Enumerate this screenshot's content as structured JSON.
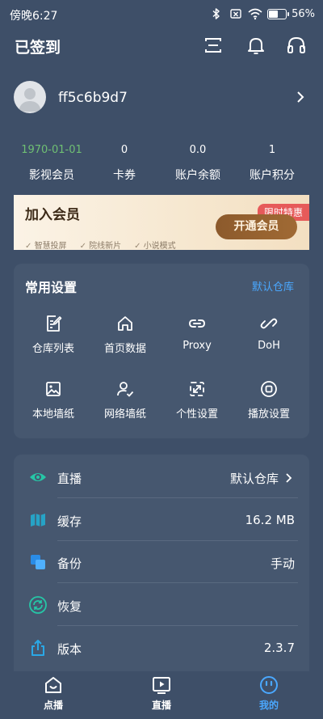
{
  "status_bar": {
    "time": "傍晚6:27",
    "battery_text": "56%",
    "battery_level": 0.56
  },
  "header": {
    "title": "已签到",
    "icons": [
      "scan-icon",
      "bell-icon",
      "headset-icon"
    ]
  },
  "profile": {
    "username": "ff5c6b9d7"
  },
  "stats": [
    {
      "value": "1970-01-01",
      "label": "影视会员",
      "value_color": "#6fbf73"
    },
    {
      "value": "0",
      "label": "卡券"
    },
    {
      "value": "0.0",
      "label": "账户余额"
    },
    {
      "value": "1",
      "label": "账户积分"
    }
  ],
  "vip": {
    "title": "加入会员",
    "badge": "限时特惠",
    "button": "开通会员",
    "features": [
      "智慧投屏",
      "院线新片",
      "小说模式"
    ]
  },
  "settings": {
    "title": "常用设置",
    "link": "默认仓库",
    "items": [
      {
        "label": "仓库列表",
        "icon": "document-edit-icon"
      },
      {
        "label": "首页数据",
        "icon": "home-icon"
      },
      {
        "label": "Proxy",
        "icon": "link-icon"
      },
      {
        "label": "DoH",
        "icon": "chain-icon"
      },
      {
        "label": "本地墙纸",
        "icon": "image-icon"
      },
      {
        "label": "网络墙纸",
        "icon": "user-check-icon"
      },
      {
        "label": "个性设置",
        "icon": "expand-icon"
      },
      {
        "label": "播放设置",
        "icon": "stop-circle-icon"
      }
    ]
  },
  "list": [
    {
      "label": "直播",
      "value": "默认仓库",
      "icon": "eye-icon",
      "has_chevron": true
    },
    {
      "label": "缓存",
      "value": "16.2 MB",
      "icon": "map-icon"
    },
    {
      "label": "备份",
      "value": "手动",
      "icon": "copy-icon"
    },
    {
      "label": "恢复",
      "value": "",
      "icon": "refresh-icon"
    },
    {
      "label": "版本",
      "value": "2.3.7",
      "icon": "share-icon"
    }
  ],
  "bottom_nav": [
    {
      "label": "点播",
      "icon": "home-smile-icon"
    },
    {
      "label": "直播",
      "icon": "play-screen-icon"
    },
    {
      "label": "我的",
      "icon": "profile-icon",
      "active": true
    }
  ],
  "colors": {
    "background": "#3e4f68",
    "card": "#46576f",
    "accent": "#4aa8ff",
    "vip_date": "#6fbf73"
  }
}
